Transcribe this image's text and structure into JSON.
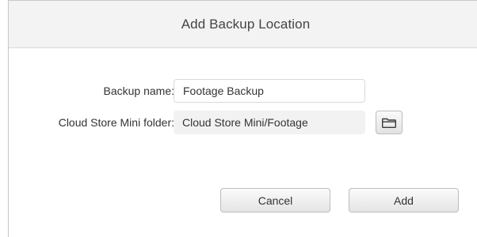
{
  "dialog": {
    "title": "Add Backup Location"
  },
  "form": {
    "backup_name_label": "Backup name:",
    "backup_name_value": "Footage Backup",
    "folder_label": "Cloud Store Mini folder:",
    "folder_value": "Cloud Store Mini/Footage"
  },
  "buttons": {
    "cancel_label": "Cancel",
    "add_label": "Add",
    "browse_icon": "folder-icon"
  }
}
